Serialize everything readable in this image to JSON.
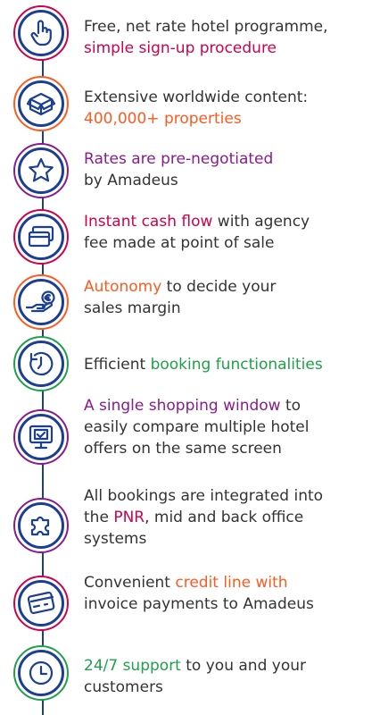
{
  "items": [
    {
      "icon": "pointer-hand-icon",
      "ring": "#8a1b8e",
      "accent": "#d1004b",
      "a": "Free, net rate hotel programme,",
      "b": "simple sign-up procedure",
      "c": ""
    },
    {
      "icon": "box-icon",
      "ring": "#ff5a1f",
      "accent": "#ff5a1f",
      "a": "Extensive worldwide content:",
      "b": "400,000+ properties",
      "c": ""
    },
    {
      "icon": "star-icon",
      "ring": "#8a1b8e",
      "accent": "#8a1b8e",
      "a": "Rates are pre-negotiated",
      "b": "by Amadeus",
      "c": ""
    },
    {
      "icon": "card-icon",
      "ring": "#d1004b",
      "accent": "#d1004b",
      "a": "Instant cash flow",
      "b": " with agency",
      "c": "fee made at point of sale"
    },
    {
      "icon": "euro-hand-icon",
      "ring": "#ff5a1f",
      "accent": "#ff5a1f",
      "a": "Autonomy",
      "b": " to decide your",
      "c": "sales margin"
    },
    {
      "icon": "clock-arrow-icon",
      "ring": "#1fa04a",
      "accent": "#1fa04a",
      "a": "Efficient ",
      "b": "booking functionalities",
      "c": ""
    },
    {
      "icon": "monitor-check-icon",
      "ring": "#8a1b8e",
      "accent": "#8a1b8e",
      "a": "A single shopping window",
      "b": " to",
      "c": "easily compare multiple hotel",
      "d": "offers on the same screen"
    },
    {
      "icon": "puzzle-icon",
      "ring": "#8a1b8e",
      "accent": "#d1004b",
      "a": "All bookings are integrated into",
      "b": "the ",
      "c": "PNR",
      "d": ", mid and back office",
      "e": "systems"
    },
    {
      "icon": "credit-card-icon",
      "ring": "#d1004b",
      "accent": "#ff5a1f",
      "a": "Convenient ",
      "b": "credit line with",
      "c": "invoice payments to Amadeus"
    },
    {
      "icon": "clock-icon",
      "ring": "#1fa04a",
      "accent": "#1fa04a",
      "a": "24/7 support",
      "b": " to you and your",
      "c": "customers"
    }
  ]
}
